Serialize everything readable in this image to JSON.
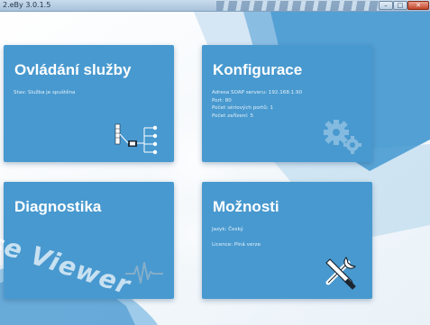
{
  "window": {
    "title": "2.eBy 3.0.1.5",
    "controls": {
      "minimize": "–",
      "maximize": "□",
      "close": "✕"
    }
  },
  "tiles": {
    "service": {
      "title": "Ovládání služby",
      "lines": [
        "Stav: Služba je spuštěna"
      ],
      "icon": "network-tree-icon"
    },
    "config": {
      "title": "Konfigurace",
      "lines": [
        "Adresa SOAP serveru: 192.168.1.90",
        "Port: 80",
        "Počet sériových portů: 1",
        "Počet zařízení: 5"
      ],
      "icon": "gears-icon"
    },
    "diag": {
      "title": "Diagnostika",
      "lines": [],
      "icon": "pulse-icon"
    },
    "options": {
      "title": "Možnosti",
      "lines": [
        "Jazyk: Český",
        "Licence: Plná verze"
      ],
      "icon": "tools-icon"
    }
  },
  "watermark": {
    "text": "se Viewer"
  },
  "colors": {
    "tile": "#4899cf",
    "accent_bg": "#4a9bd2",
    "titlebar": "#b6cde2"
  }
}
